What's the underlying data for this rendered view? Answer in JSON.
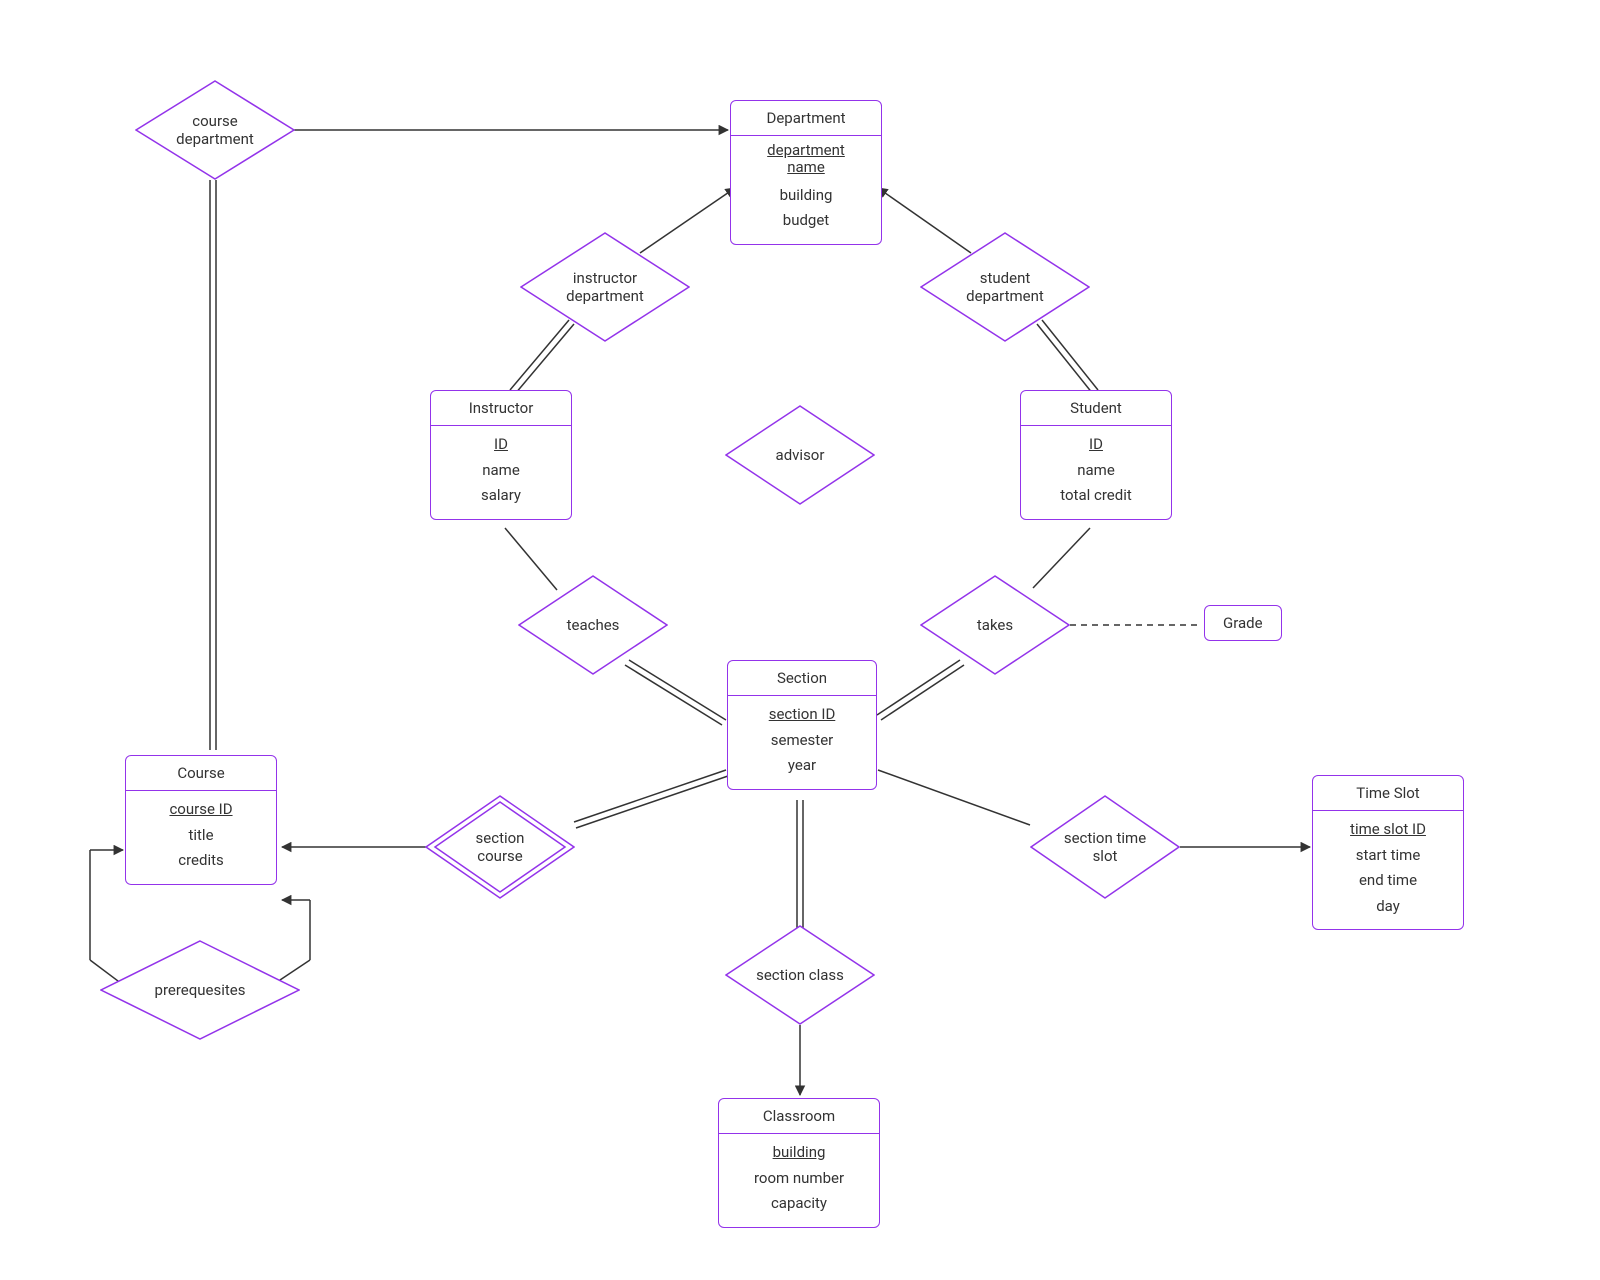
{
  "entities": {
    "department": {
      "title": "Department",
      "key": "department name",
      "attr1": "building",
      "attr2": "budget"
    },
    "instructor": {
      "title": "Instructor",
      "key": "ID",
      "attr1": "name",
      "attr2": "salary"
    },
    "student": {
      "title": "Student",
      "key": "ID",
      "attr1": "name",
      "attr2": "total credit"
    },
    "section": {
      "title": "Section",
      "key": "section ID",
      "attr1": "semester",
      "attr2": "year"
    },
    "course": {
      "title": "Course",
      "key": "course ID",
      "attr1": "title",
      "attr2": "credits"
    },
    "classroom": {
      "title": "Classroom",
      "key": "building",
      "attr1": "room number",
      "attr2": "capacity"
    },
    "timeslot": {
      "title": "Time Slot",
      "key": "time slot ID",
      "attr1": "start time",
      "attr2": "end time",
      "attr3": "day"
    }
  },
  "relationships": {
    "course_department": "course department",
    "instructor_department": "instructor department",
    "student_department": "student department",
    "advisor": "advisor",
    "teaches": "teaches",
    "takes": "takes",
    "section_course": "section course",
    "section_class": "section class",
    "section_time_slot": "section time slot",
    "prerequesites": "prerequesites"
  },
  "assoc": {
    "grade": "Grade"
  }
}
